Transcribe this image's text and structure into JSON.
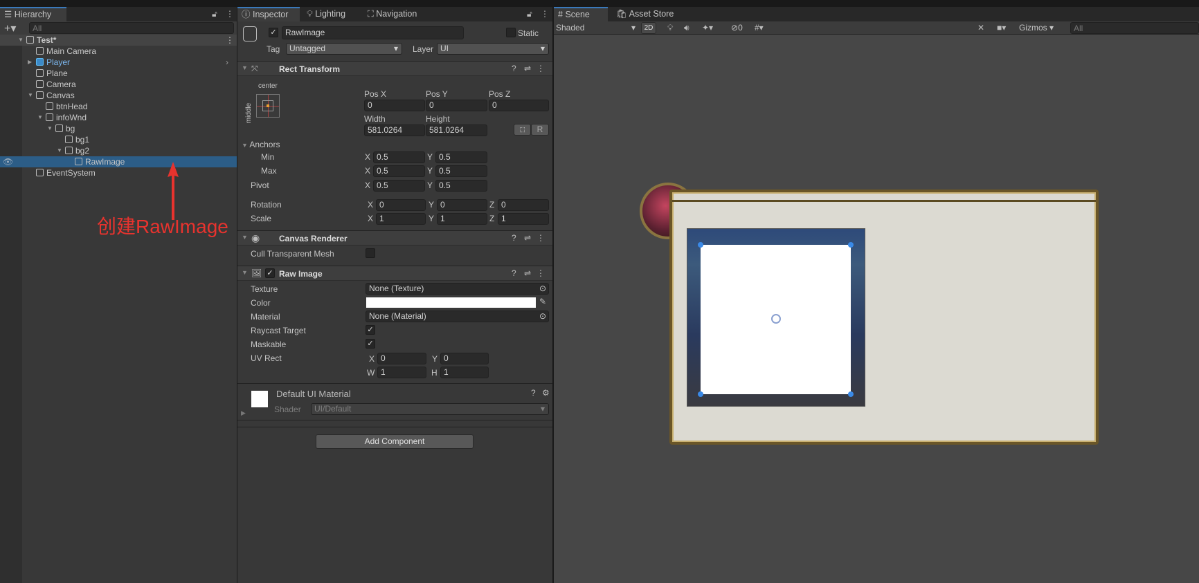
{
  "hierarchy": {
    "tab": "Hierarchy",
    "search_placeholder": "All",
    "items": [
      {
        "label": "Test*",
        "depth": 0,
        "scene": true
      },
      {
        "label": "Main Camera",
        "depth": 1
      },
      {
        "label": "Player",
        "depth": 1,
        "prefab": true
      },
      {
        "label": "Plane",
        "depth": 1
      },
      {
        "label": "Camera",
        "depth": 1
      },
      {
        "label": "Canvas",
        "depth": 1,
        "expanded": true
      },
      {
        "label": "btnHead",
        "depth": 2
      },
      {
        "label": "infoWnd",
        "depth": 2,
        "expanded": true
      },
      {
        "label": "bg",
        "depth": 3,
        "expanded": true
      },
      {
        "label": "bg1",
        "depth": 4
      },
      {
        "label": "bg2",
        "depth": 4,
        "expanded": true
      },
      {
        "label": "RawImage",
        "depth": 5,
        "selected": true
      },
      {
        "label": "EventSystem",
        "depth": 1
      }
    ]
  },
  "annotation": {
    "text": "创建RawImage",
    "color": "#e8332e"
  },
  "inspector": {
    "tabs": [
      "Inspector",
      "Lighting",
      "Navigation"
    ],
    "name": "RawImage",
    "static_label": "Static",
    "tag_label": "Tag",
    "tag_value": "Untagged",
    "layer_label": "Layer",
    "layer_value": "UI",
    "rect": {
      "title": "Rect Transform",
      "anchor_h": "center",
      "anchor_v": "middle",
      "posx_label": "Pos X",
      "posy_label": "Pos Y",
      "posz_label": "Pos Z",
      "posx": "0",
      "posy": "0",
      "posz": "0",
      "width_label": "Width",
      "height_label": "Height",
      "width": "581.0264",
      "height": "581.0264",
      "r_label": "R",
      "anchors_label": "Anchors",
      "min_label": "Min",
      "max_label": "Max",
      "pivot_label": "Pivot",
      "min_x": "0.5",
      "min_y": "0.5",
      "max_x": "0.5",
      "max_y": "0.5",
      "pivot_x": "0.5",
      "pivot_y": "0.5",
      "rotation_label": "Rotation",
      "scale_label": "Scale",
      "rot_x": "0",
      "rot_y": "0",
      "rot_z": "0",
      "scale_x": "1",
      "scale_y": "1",
      "scale_z": "1",
      "x": "X",
      "y": "Y",
      "z": "Z"
    },
    "canvas_renderer": {
      "title": "Canvas Renderer",
      "cull_label": "Cull Transparent Mesh",
      "cull": false
    },
    "raw_image": {
      "title": "Raw Image",
      "texture_label": "Texture",
      "texture": "None (Texture)",
      "color_label": "Color",
      "color": "#ffffff",
      "material_label": "Material",
      "material": "None (Material)",
      "raycast_label": "Raycast Target",
      "raycast": true,
      "maskable_label": "Maskable",
      "maskable": true,
      "uv_label": "UV Rect",
      "uv_x": "0",
      "uv_y": "0",
      "uv_w": "1",
      "uv_h": "1",
      "w": "W",
      "h": "H"
    },
    "material": {
      "title": "Default UI Material",
      "shader_label": "Shader",
      "shader": "UI/Default"
    },
    "add_component": "Add Component"
  },
  "scene": {
    "tabs": [
      "Scene",
      "Asset Store"
    ],
    "shading": "Shaded",
    "mode_2d": "2D",
    "hidden_count": "0",
    "gizmos": "Gizmos",
    "search_placeholder": "All"
  }
}
